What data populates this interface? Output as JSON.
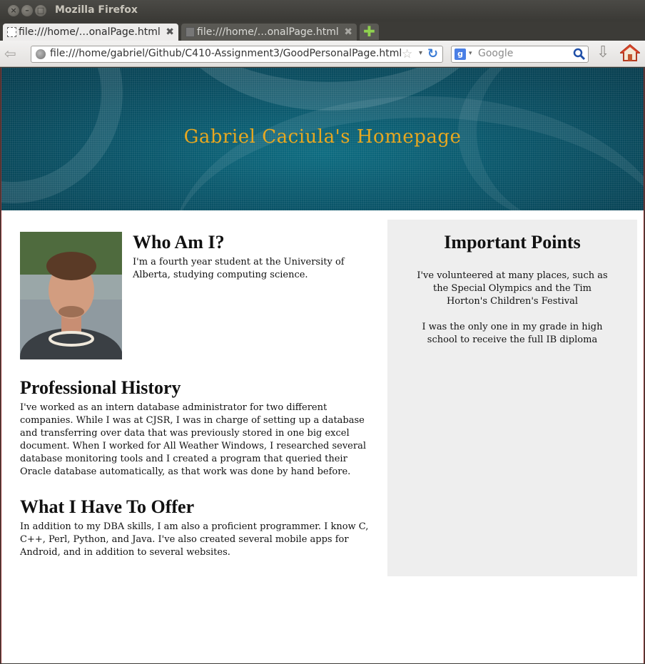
{
  "window": {
    "title": "Mozilla Firefox",
    "buttons": [
      "×",
      "–",
      "□"
    ]
  },
  "tabs": [
    {
      "label": "file:///home/…onalPage.html",
      "close": "✖",
      "active": true
    },
    {
      "label": "file:///home/…onalPage.html",
      "close": "✖",
      "active": false
    }
  ],
  "new_tab": "✚",
  "navbar": {
    "back": "⇦",
    "url": "file:///home/gabriel/Github/C410-Assignment3/GoodPersonalPage.html",
    "star": "☆",
    "dropdown": "▾",
    "reload": "↻",
    "search_engine": "g",
    "search_dropdown": "▾",
    "search_placeholder": "Google",
    "download": "⇩"
  },
  "page": {
    "banner_title": "Gabriel Caciula's Homepage",
    "who": {
      "heading": "Who Am I?",
      "text": "I'm a fourth year student at the University of Alberta, studying computing science."
    },
    "professional": {
      "heading": "Professional History",
      "text": "I've worked as an intern database administrator for two different companies. While I was at CJSR, I was in charge of setting up a database and transferring over data that was previously stored in one big excel document. When I worked for All Weather Windows, I researched several database monitoring tools and I created a program that queried their Oracle database automatically, as that work was done by hand before."
    },
    "offer": {
      "heading": "What I Have To Offer",
      "text": "In addition to my DBA skills, I am also a proficient programmer. I know C, C++, Perl, Python, and Java. I've also created several mobile apps for Android, and in addition to several websites."
    },
    "sidebar": {
      "heading": "Important Points",
      "points": [
        "I've volunteered at many places, such as the Special Olympics and the Tim Horton's Children's Festival",
        "I was the only one in my grade in high school to receive the full IB diploma"
      ]
    }
  },
  "colors": {
    "banner_title": "#e8a820",
    "banner_bg": "#0a5468",
    "sidebar_bg": "#eeeeee"
  }
}
